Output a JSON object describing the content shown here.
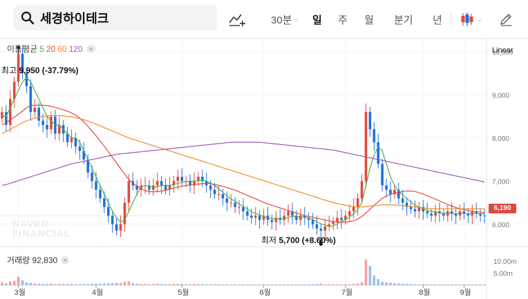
{
  "search": {
    "query": "세경하이테크",
    "icon": "search-icon"
  },
  "toolbar": {
    "indicator_icon": "add-indicator-icon",
    "periods": [
      {
        "label": "30분",
        "active": false
      },
      {
        "label": "일",
        "active": true
      },
      {
        "label": "주",
        "active": false
      },
      {
        "label": "월",
        "active": false
      },
      {
        "label": "분기",
        "active": false
      },
      {
        "label": "년",
        "active": false
      }
    ],
    "chart_type_icon": "candlestick-icon",
    "draw_icon": "pencil-icon"
  },
  "legend": {
    "label": "이동평균",
    "ma5": "5",
    "ma20": "20",
    "ma60": "60",
    "ma120": "120",
    "close": "×"
  },
  "scale_mode": "Linear",
  "annotations": {
    "high_prefix": "최고",
    "high_value": "9,950 (-37.79%)",
    "low_prefix": "최저",
    "low_value": "5,700 (+8.60%)"
  },
  "watermark": {
    "line1": "NAVER",
    "line2": "FINANCIAL"
  },
  "current_price": "6,190",
  "volume": {
    "label": "거래량",
    "value": "92,830",
    "close": "×",
    "ticks": [
      "10.00m",
      "5.00m"
    ]
  },
  "colors": {
    "up": "#e2473e",
    "down": "#1f70d6",
    "ma5": "#4cb043",
    "ma20": "#e2473e",
    "ma60": "#f08a2c",
    "ma120": "#9b59b6"
  },
  "chart_data": {
    "type": "candlestick",
    "title": "",
    "scale": "linear",
    "y_ticks": [
      "10,000",
      "9,000",
      "8,000",
      "7,000",
      "6,000"
    ],
    "x_ticks": [
      "3월",
      "4월",
      "5월",
      "6월",
      "7월",
      "8월",
      "9월"
    ],
    "ylim": [
      5500,
      10300
    ],
    "high": 9950,
    "low": 5700,
    "last": 6190,
    "closes": [
      8600,
      8300,
      8900,
      9300,
      9950,
      9500,
      9200,
      8600,
      8700,
      8400,
      8300,
      8200,
      8500,
      8100,
      8300,
      8100,
      7900,
      8000,
      7800,
      7700,
      7500,
      7200,
      7000,
      6800,
      6600,
      6400,
      6200,
      6000,
      5850,
      6000,
      6500,
      7000,
      6900,
      6800,
      6900,
      6900,
      6800,
      6900,
      7000,
      6900,
      6800,
      6900,
      7000,
      7100,
      7000,
      7000,
      6900,
      7000,
      7100,
      7000,
      6900,
      6800,
      6700,
      6700,
      6600,
      6500,
      6500,
      6400,
      6400,
      6300,
      6200,
      6150,
      6200,
      6100,
      6200,
      6100,
      6050,
      6150,
      6100,
      6200,
      6300,
      6200,
      6100,
      6200,
      6150,
      6100,
      6000,
      5900,
      5850,
      5950,
      6000,
      6050,
      6150,
      6100,
      6200,
      6300,
      6400,
      6600,
      7000,
      8600,
      8200,
      7900,
      7400,
      6900,
      6800,
      6700,
      6800,
      6600,
      6500,
      6400,
      6350,
      6300,
      6400,
      6300,
      6250,
      6200,
      6300,
      6250,
      6200,
      6300,
      6250,
      6200,
      6300,
      6250,
      6200,
      6300,
      6250,
      6200,
      6190
    ],
    "series": [
      {
        "name": "5",
        "values": [
          8500,
          8500,
          8700,
          8900,
          9100,
          9300,
          9400,
          9300,
          9100,
          8900,
          8700,
          8500,
          8400,
          8300,
          8300,
          8200,
          8100,
          8000,
          8000,
          7900,
          7700,
          7500,
          7300,
          7100,
          6900,
          6700,
          6500,
          6300,
          6150,
          6050,
          6100,
          6300,
          6500,
          6700,
          6850,
          6900,
          6880,
          6860,
          6870,
          6900,
          6900,
          6900,
          6920,
          6950,
          6970,
          6990,
          7000,
          7000,
          7010,
          7020,
          7000,
          6950,
          6900,
          6820,
          6740,
          6660,
          6590,
          6530,
          6470,
          6410,
          6350,
          6290,
          6250,
          6210,
          6180,
          6150,
          6130,
          6130,
          6120,
          6130,
          6160,
          6180,
          6180,
          6170,
          6160,
          6140,
          6110,
          6060,
          6010,
          5980,
          5950,
          5960,
          6010,
          6060,
          6110,
          6170,
          6240,
          6340,
          6500,
          6900,
          7300,
          7600,
          7800,
          7700,
          7400,
          7100,
          6900,
          6760,
          6680,
          6600,
          6520,
          6440,
          6400,
          6360,
          6320,
          6300,
          6280,
          6260,
          6250,
          6260,
          6250,
          6240,
          6250,
          6250,
          6240,
          6250,
          6250,
          6240,
          6240
        ]
      },
      {
        "name": "20",
        "values": [
          8300,
          8350,
          8420,
          8480,
          8550,
          8620,
          8700,
          8750,
          8760,
          8760,
          8760,
          8750,
          8730,
          8710,
          8680,
          8650,
          8620,
          8580,
          8530,
          8460,
          8370,
          8270,
          8160,
          8050,
          7930,
          7810,
          7680,
          7550,
          7420,
          7290,
          7160,
          7040,
          6950,
          6880,
          6820,
          6780,
          6760,
          6750,
          6760,
          6770,
          6790,
          6810,
          6840,
          6860,
          6880,
          6900,
          6910,
          6920,
          6930,
          6940,
          6950,
          6940,
          6920,
          6900,
          6880,
          6850,
          6820,
          6790,
          6750,
          6710,
          6670,
          6630,
          6590,
          6550,
          6510,
          6470,
          6440,
          6410,
          6380,
          6350,
          6320,
          6290,
          6260,
          6230,
          6200,
          6180,
          6160,
          6140,
          6120,
          6100,
          6080,
          6060,
          6050,
          6050,
          6050,
          6060,
          6080,
          6120,
          6180,
          6260,
          6350,
          6440,
          6520,
          6600,
          6650,
          6690,
          6720,
          6740,
          6760,
          6770,
          6770,
          6760,
          6730,
          6700,
          6660,
          6620,
          6580,
          6540,
          6500,
          6460,
          6420,
          6390,
          6360,
          6340,
          6320,
          6300,
          6290,
          6280,
          6270
        ]
      },
      {
        "name": "60",
        "values": [
          8100,
          8150,
          8200,
          8250,
          8300,
          8350,
          8400,
          8430,
          8460,
          8480,
          8500,
          8510,
          8520,
          8520,
          8520,
          8510,
          8500,
          8490,
          8470,
          8450,
          8420,
          8390,
          8360,
          8320,
          8280,
          8240,
          8200,
          8160,
          8120,
          8080,
          8040,
          8000,
          7970,
          7940,
          7910,
          7880,
          7850,
          7820,
          7790,
          7760,
          7730,
          7700,
          7670,
          7640,
          7610,
          7580,
          7550,
          7520,
          7490,
          7460,
          7430,
          7400,
          7370,
          7340,
          7310,
          7280,
          7250,
          7220,
          7190,
          7160,
          7130,
          7100,
          7070,
          7040,
          7010,
          6980,
          6950,
          6920,
          6890,
          6860,
          6830,
          6800,
          6770,
          6740,
          6710,
          6680,
          6650,
          6620,
          6590,
          6560,
          6530,
          6500,
          6480,
          6460,
          6440,
          6420,
          6410,
          6400,
          6400,
          6410,
          6420,
          6430,
          6440,
          6450,
          6450,
          6450,
          6450,
          6440,
          6430,
          6420,
          6410,
          6400,
          6390,
          6380,
          6370,
          6360,
          6360,
          6360,
          6360,
          6360,
          6360,
          6360,
          6360,
          6360,
          6360,
          6360,
          6360,
          6360,
          6360
        ]
      },
      {
        "name": "120",
        "values": [
          6900,
          6920,
          6950,
          6980,
          7010,
          7040,
          7070,
          7100,
          7130,
          7160,
          7190,
          7220,
          7250,
          7280,
          7310,
          7340,
          7370,
          7400,
          7420,
          7440,
          7460,
          7480,
          7500,
          7520,
          7540,
          7560,
          7580,
          7600,
          7620,
          7630,
          7640,
          7650,
          7660,
          7670,
          7680,
          7690,
          7700,
          7710,
          7720,
          7730,
          7740,
          7750,
          7760,
          7770,
          7780,
          7790,
          7800,
          7810,
          7820,
          7830,
          7840,
          7850,
          7860,
          7870,
          7880,
          7890,
          7900,
          7900,
          7900,
          7900,
          7900,
          7900,
          7900,
          7900,
          7890,
          7880,
          7870,
          7860,
          7850,
          7840,
          7830,
          7820,
          7810,
          7800,
          7790,
          7780,
          7770,
          7760,
          7750,
          7740,
          7730,
          7720,
          7700,
          7680,
          7660,
          7640,
          7620,
          7600,
          7580,
          7560,
          7540,
          7520,
          7500,
          7480,
          7460,
          7440,
          7420,
          7400,
          7380,
          7360,
          7340,
          7320,
          7300,
          7280,
          7260,
          7240,
          7220,
          7200,
          7180,
          7160,
          7140,
          7120,
          7100,
          7080,
          7060,
          7040,
          7020,
          7000,
          6980
        ]
      }
    ],
    "volume": [
      1.2,
      0.8,
      1.5,
      1.8,
      3.5,
      2.0,
      1.2,
      0.9,
      0.7,
      0.6,
      0.6,
      0.5,
      0.7,
      0.5,
      0.6,
      0.5,
      0.5,
      0.5,
      0.4,
      0.4,
      0.5,
      0.5,
      0.6,
      0.6,
      0.6,
      0.7,
      0.8,
      0.9,
      1.0,
      0.9,
      1.4,
      1.6,
      0.8,
      0.6,
      0.5,
      0.5,
      0.4,
      0.5,
      0.6,
      0.5,
      0.4,
      0.5,
      0.5,
      0.6,
      0.5,
      0.4,
      0.4,
      0.5,
      0.5,
      0.4,
      0.4,
      0.4,
      0.4,
      0.3,
      0.3,
      0.3,
      0.3,
      0.3,
      0.3,
      0.3,
      0.3,
      0.3,
      0.3,
      0.3,
      0.3,
      0.3,
      0.3,
      0.3,
      0.3,
      0.3,
      0.3,
      0.3,
      0.3,
      0.3,
      0.3,
      0.3,
      0.4,
      0.5,
      0.6,
      0.4,
      0.4,
      0.3,
      0.4,
      0.3,
      0.4,
      0.4,
      0.5,
      0.7,
      1.2,
      10.5,
      8.0,
      4.0,
      2.5,
      1.5,
      1.2,
      1.0,
      0.8,
      0.7,
      0.6,
      0.5,
      0.5,
      0.4,
      0.4,
      0.4,
      0.3,
      0.3,
      0.3,
      0.3,
      0.3,
      0.3,
      0.3,
      0.3,
      0.3,
      0.3,
      0.3,
      0.3,
      0.3,
      0.3,
      0.3
    ]
  }
}
